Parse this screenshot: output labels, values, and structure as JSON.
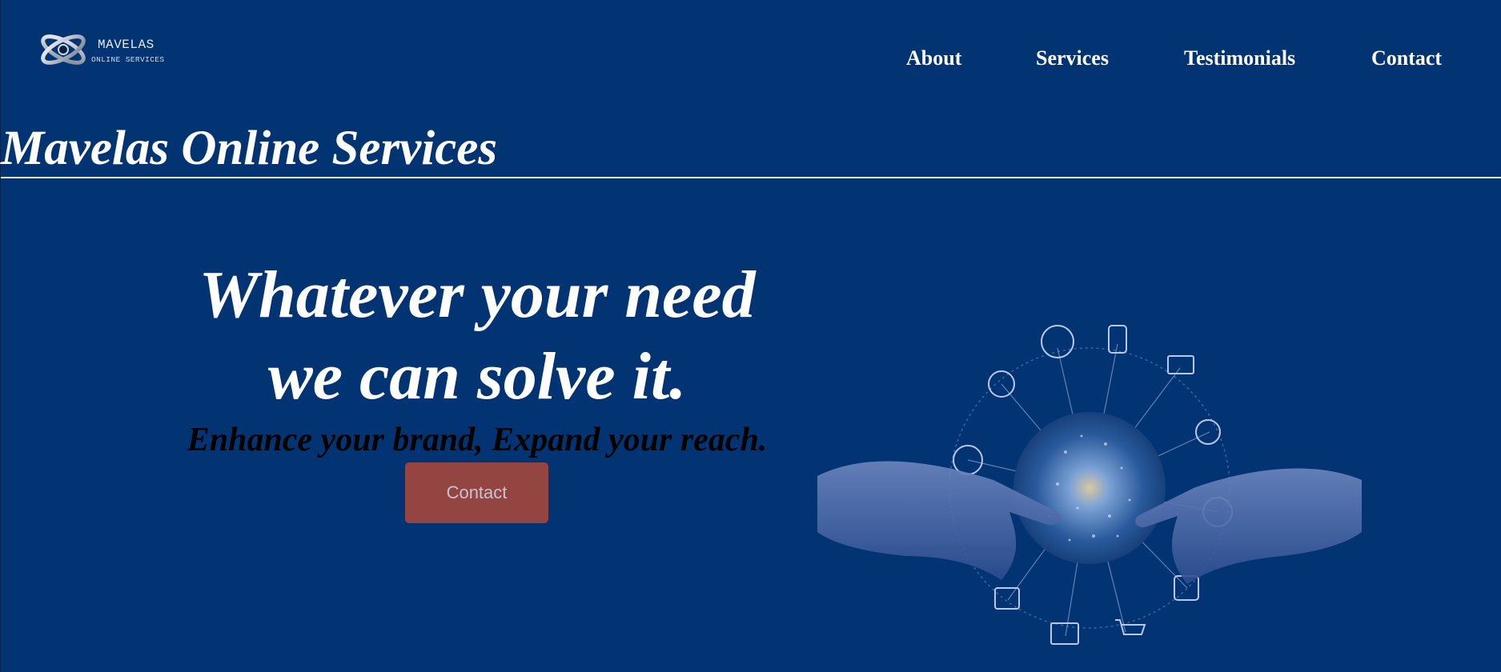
{
  "logo": {
    "name": "MAVELAS",
    "subtitle": "ONLINE SERVICES"
  },
  "nav": {
    "items": [
      {
        "label": "About"
      },
      {
        "label": "Services"
      },
      {
        "label": "Testimonials"
      },
      {
        "label": "Contact"
      }
    ]
  },
  "site_title": "Mavelas Online Services",
  "hero": {
    "headline_line1": "Whatever your need",
    "headline_line2": "we can solve it.",
    "tagline": "Enhance your brand, Expand your reach.",
    "button_label": "Contact"
  },
  "colors": {
    "background": "#023372",
    "button": "#944541",
    "text_primary": "#ffffff",
    "tagline": "#000000"
  },
  "illustration": {
    "icon": "hands-network-globe-icon"
  }
}
